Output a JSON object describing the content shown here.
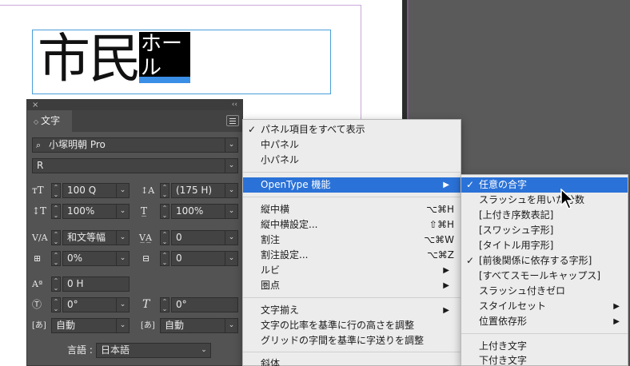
{
  "canvas": {
    "frame_text": "市民",
    "frame_selected_text": "ホール"
  },
  "char_panel": {
    "close_glyph": "×",
    "collapse_glyph": "‹‹",
    "tab_arrow": "◇",
    "tab_label": "文字",
    "font_family": "小塚明朝 Pro",
    "font_style": "R",
    "font_size": "100 Q",
    "leading": "(175 H)",
    "vertical_scale": "100%",
    "horizontal_scale": "100%",
    "kerning": "和文等幅",
    "tracking": "0",
    "tsume": "0%",
    "mojikumi_aki": "0",
    "baseline_shift": "0 H",
    "character_rotation": "0°",
    "skew": "0°",
    "aki_before": "自動",
    "aki_after": "自動",
    "language_label": "言語 :",
    "language": "日本語"
  },
  "main_menu": {
    "items": [
      {
        "label": "パネル項目をすべて表示",
        "checked": "✓"
      },
      {
        "label": "中パネル"
      },
      {
        "label": "小パネル"
      },
      {
        "label": "OpenType 機能",
        "submenu": "▶"
      },
      {
        "label": "縦中横",
        "shortcut": "⌥⌘H"
      },
      {
        "label": "縦中横設定...",
        "shortcut": "⇧⌘H"
      },
      {
        "label": "割注",
        "shortcut": "⌥⌘W"
      },
      {
        "label": "割注設定...",
        "shortcut": "⌥⌘Z"
      },
      {
        "label": "ルビ",
        "submenu": "▶"
      },
      {
        "label": "圏点",
        "submenu": "▶"
      },
      {
        "label": "文字揃え",
        "submenu": "▶"
      },
      {
        "label": "文字の比率を基準に行の高さを調整"
      },
      {
        "label": "グリッドの字間を基準に字送りを調整"
      },
      {
        "label": "斜体"
      }
    ]
  },
  "opentype_menu": {
    "items": [
      {
        "label": "任意の合字",
        "checked": "✓"
      },
      {
        "label": "スラッシュを用いた分数"
      },
      {
        "label": "[上付き序数表記]"
      },
      {
        "label": "[スワッシュ字形]"
      },
      {
        "label": "[タイトル用字形]"
      },
      {
        "label": "[前後関係に依存する字形]",
        "checked": "✓"
      },
      {
        "label": "[すべてスモールキャップス]"
      },
      {
        "label": "スラッシュ付きゼロ"
      },
      {
        "label": "スタイルセット",
        "submenu": "▶"
      },
      {
        "label": "位置依存形",
        "submenu": "▶"
      },
      {
        "label": "上付き文字"
      },
      {
        "label": "下付き文字"
      }
    ]
  },
  "colors": {
    "selection_blue": "#2a72d8",
    "frame_blue": "#4a9ed8",
    "panel_gray": "#535353"
  }
}
